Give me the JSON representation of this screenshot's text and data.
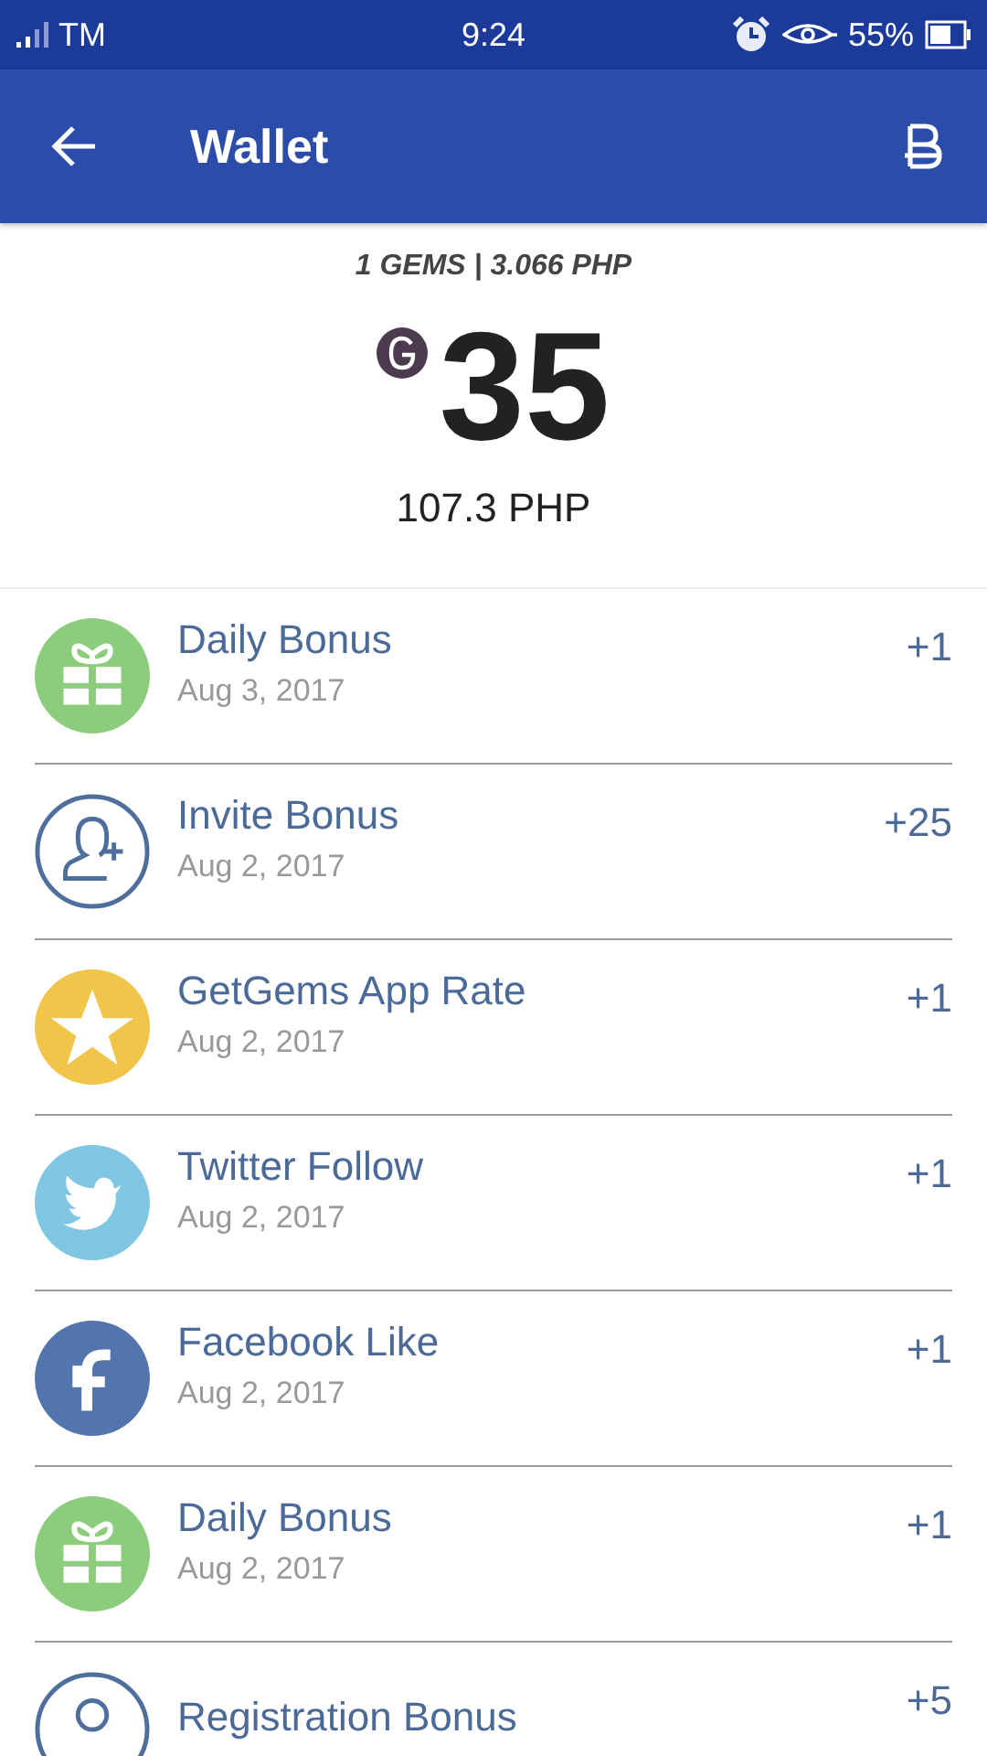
{
  "status_bar": {
    "carrier": "TM",
    "time": "9:24",
    "battery": "55%"
  },
  "app_bar": {
    "title": "Wallet"
  },
  "summary": {
    "rate": "1 GEMS | 3.066 PHP",
    "balance": "35",
    "fiat": "107.3 PHP"
  },
  "transactions": [
    {
      "kind": "gift",
      "title": "Daily Bonus",
      "date": "Aug 3, 2017",
      "amount": "+1"
    },
    {
      "kind": "invite",
      "title": "Invite Bonus",
      "date": "Aug 2, 2017",
      "amount": "+25"
    },
    {
      "kind": "star",
      "title": "GetGems App Rate",
      "date": "Aug 2, 2017",
      "amount": "+1"
    },
    {
      "kind": "twitter",
      "title": "Twitter Follow",
      "date": "Aug 2, 2017",
      "amount": "+1"
    },
    {
      "kind": "facebook",
      "title": "Facebook Like",
      "date": "Aug 2, 2017",
      "amount": "+1"
    },
    {
      "kind": "gift",
      "title": "Daily Bonus",
      "date": "Aug 2, 2017",
      "amount": "+1"
    },
    {
      "kind": "registration",
      "title": "Registration Bonus",
      "amount": "+5"
    }
  ]
}
